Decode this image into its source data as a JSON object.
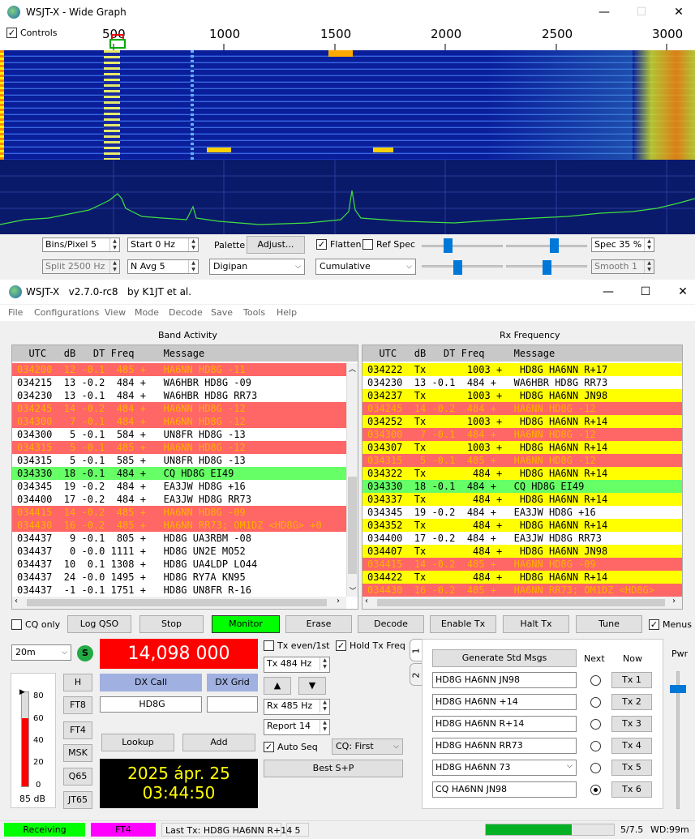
{
  "wide_graph": {
    "title": "WSJT-X - Wide Graph",
    "controls_label": "Controls",
    "freq_ticks": [
      "500",
      "1000",
      "1500",
      "2000",
      "2500",
      "3000"
    ],
    "bins_pixel": "Bins/Pixel  5",
    "start": "Start 0 Hz",
    "palette_label": "Palette",
    "adjust_button": "Adjust...",
    "flatten_label": "Flatten",
    "ref_spec_label": "Ref Spec",
    "spec": "Spec 35 %",
    "split": "Split  2500  Hz",
    "n_avg": "N Avg 5",
    "palette_value": "Digipan",
    "cumulative_value": "Cumulative",
    "smooth": "Smooth   1"
  },
  "main": {
    "title": "WSJT-X   v2.7.0-rc8   by K1JT et al.",
    "menu": [
      "File",
      "Configurations",
      "View",
      "Mode",
      "Decode",
      "Save",
      "Tools",
      "Help"
    ],
    "band_activity_title": "Band Activity",
    "rx_frequency_title": "Rx Frequency",
    "col_header": "  UTC   dB   DT Freq     Message",
    "band_rows": [
      {
        "t": "034200  12 -0.1  485 +   HA6NN HD8G -11",
        "c": "r-red"
      },
      {
        "t": "034215  13 -0.2  484 +   WA6HBR HD8G -09",
        "c": "r-white"
      },
      {
        "t": "034230  13 -0.1  484 +   WA6HBR HD8G RR73",
        "c": "r-white"
      },
      {
        "t": "034245  14 -0.2  484 +   HA6NN HD8G -12",
        "c": "r-red"
      },
      {
        "t": "034300   7 -0.1  484 +   HA6NN HD8G -12",
        "c": "r-red"
      },
      {
        "t": "034300   5 -0.1  584 +   UN8FR HD8G -13",
        "c": "r-white"
      },
      {
        "t": "034315   5 -0.1  485 +   HA6NN HD8G -12",
        "c": "r-red"
      },
      {
        "t": "034315   5 -0.1  585 +   UN8FR HD8G -13",
        "c": "r-white"
      },
      {
        "t": "034330  18 -0.1  484 +   CQ HD8G EI49",
        "c": "r-green"
      },
      {
        "t": "034345  19 -0.2  484 +   EA3JW HD8G +16",
        "c": "r-white"
      },
      {
        "t": "034400  17 -0.2  484 +   EA3JW HD8G RR73",
        "c": "r-white"
      },
      {
        "t": "034415  14 -0.2  485 +   HA6NN HD8G -09",
        "c": "r-red"
      },
      {
        "t": "034430  16 -0.2  485 +   HA6NN RR73; OM1DZ <HD8G> +0",
        "c": "r-red"
      },
      {
        "t": "034437   9 -0.1  805 +   HD8G UA3RBM -08",
        "c": "r-white"
      },
      {
        "t": "034437   0 -0.0 1111 +   HD8G UN2E MO52",
        "c": "r-white"
      },
      {
        "t": "034437  10  0.1 1308 +   HD8G UA4LDP LO44",
        "c": "r-white"
      },
      {
        "t": "034437  24 -0.0 1495 +   HD8G RY7A KN95",
        "c": "r-white"
      },
      {
        "t": "034437  -1 -0.1 1751 +   HD8G UN8FR R-16",
        "c": "r-white"
      }
    ],
    "rx_rows": [
      {
        "t": "034222  Tx       1003 +   HD8G HA6NN R+17",
        "c": "r-yellow"
      },
      {
        "t": "034230  13 -0.1  484 +   WA6HBR HD8G RR73",
        "c": "r-white"
      },
      {
        "t": "034237  Tx       1003 +   HD8G HA6NN JN98",
        "c": "r-yellow"
      },
      {
        "t": "034245  14 -0.2  484 +   HA6NN HD8G -12",
        "c": "r-red"
      },
      {
        "t": "034252  Tx       1003 +   HD8G HA6NN R+14",
        "c": "r-yellow"
      },
      {
        "t": "034300   7 -0.1  484 +   HA6NN HD8G -12",
        "c": "r-red"
      },
      {
        "t": "034307  Tx       1003 +   HD8G HA6NN R+14",
        "c": "r-yellow"
      },
      {
        "t": "034315   5 -0.1  485 +   HA6NN HD8G -12",
        "c": "r-red"
      },
      {
        "t": "034322  Tx        484 +   HD8G HA6NN R+14",
        "c": "r-yellow"
      },
      {
        "t": "034330  18 -0.1  484 +   CQ HD8G EI49",
        "c": "r-green"
      },
      {
        "t": "034337  Tx        484 +   HD8G HA6NN R+14",
        "c": "r-yellow"
      },
      {
        "t": "034345  19 -0.2  484 +   EA3JW HD8G +16",
        "c": "r-white"
      },
      {
        "t": "034352  Tx        484 +   HD8G HA6NN R+14",
        "c": "r-yellow"
      },
      {
        "t": "034400  17 -0.2  484 +   EA3JW HD8G RR73",
        "c": "r-white"
      },
      {
        "t": "034407  Tx        484 +   HD8G HA6NN JN98",
        "c": "r-yellow"
      },
      {
        "t": "034415  14 -0.2  485 +   HA6NN HD8G -09",
        "c": "r-red"
      },
      {
        "t": "034422  Tx        484 +   HD8G HA6NN R+14",
        "c": "r-yellow"
      },
      {
        "t": "034430  16 -0.2  485 +   HA6NN RR73; OM1DZ <HD8G>",
        "c": "r-red"
      }
    ],
    "controls": {
      "cq_only": "CQ only",
      "log_qso": "Log QSO",
      "stop": "Stop",
      "monitor": "Monitor",
      "erase": "Erase",
      "decode": "Decode",
      "enable_tx": "Enable Tx",
      "halt_tx": "Halt Tx",
      "tune": "Tune",
      "menus": "Menus"
    },
    "band": "20m",
    "s_label": "S",
    "frequency": "14,098 000",
    "h_btn": "H",
    "ft8_btn": "FT8",
    "ft4_btn": "FT4",
    "msk_btn": "MSK",
    "q65_btn": "Q65",
    "jt65_btn": "JT65",
    "dx_call_label": "DX Call",
    "dx_grid_label": "DX Grid",
    "dx_call_value": "HD8G",
    "dx_grid_value": "",
    "lookup": "Lookup",
    "add": "Add",
    "date": "2025 ápr. 25",
    "time": "03:44:50",
    "meter_ticks": [
      "80",
      "60",
      "40",
      "20",
      "0"
    ],
    "meter_db": "85 dB",
    "meter_level": 0.72,
    "tx_even_label": "Tx even/1st",
    "hold_tx_freq_label": "Hold Tx Freq",
    "tx_hz": "Tx  484 Hz",
    "rx_hz": "Rx  485 Hz",
    "up_arrow": "▲",
    "down_arrow": "▼",
    "report": "Report 14",
    "auto_seq_label": "Auto Seq",
    "cq_first": "CQ: First",
    "best_sp": "Best S+P",
    "tab1": "1",
    "tab2": "2",
    "gen_std_msgs": "Generate Std Msgs",
    "next_label": "Next",
    "now_label": "Now",
    "tx_msgs": [
      {
        "msg": "HD8G HA6NN JN98",
        "btn": "Tx 1",
        "selected": false
      },
      {
        "msg": "HD8G HA6NN +14",
        "btn": "Tx 2",
        "selected": false
      },
      {
        "msg": "HD8G HA6NN R+14",
        "btn": "Tx 3",
        "selected": false
      },
      {
        "msg": "HD8G HA6NN RR73",
        "btn": "Tx 4",
        "selected": false
      },
      {
        "msg": "HD8G HA6NN 73",
        "btn": "Tx 5",
        "selected": false
      },
      {
        "msg": "CQ HA6NN JN98",
        "btn": "Tx 6",
        "selected": true
      }
    ],
    "pwr_label": "Pwr",
    "status": {
      "receiving": "Receiving",
      "mode": "FT4",
      "last_tx": "Last Tx: HD8G HA6NN R+14",
      "count": "5",
      "progress": "5/7.5",
      "wd": "WD:99m",
      "progress_fraction": 0.67
    }
  },
  "colors": {
    "red_row": "#ff6666",
    "yellow_row": "#ffff00",
    "green_row": "#66ff66",
    "monitor_green": "#00ff00",
    "freq_red": "#ff0000",
    "dx_blue": "#a0b0e0",
    "status_green": "#00ff00",
    "status_magenta": "#ff00ff"
  }
}
